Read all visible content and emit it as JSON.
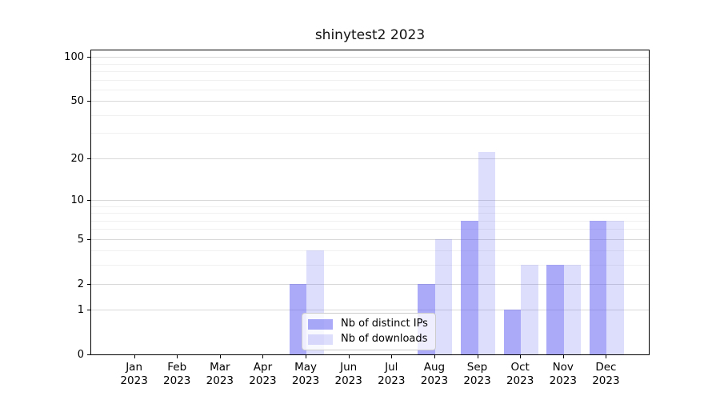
{
  "chart_data": {
    "type": "bar",
    "title": "shinytest2 2023",
    "categories": [
      "Jan 2023",
      "Feb 2023",
      "Mar 2023",
      "Apr 2023",
      "May 2023",
      "Jun 2023",
      "Jul 2023",
      "Aug 2023",
      "Sep 2023",
      "Oct 2023",
      "Nov 2023",
      "Dec 2023"
    ],
    "series": [
      {
        "name": "Nb of distinct IPs",
        "color": "rgba(85,85,242,0.5)",
        "values": [
          0,
          0,
          0,
          0,
          2,
          0,
          0,
          2,
          7,
          1,
          3,
          7
        ]
      },
      {
        "name": "Nb of downloads",
        "color": "rgba(85,85,242,0.2)",
        "values": [
          0,
          0,
          0,
          0,
          4,
          0,
          0,
          5,
          22,
          3,
          3,
          7
        ]
      }
    ],
    "yscale": "log1p",
    "yticks": [
      0,
      1,
      2,
      5,
      10,
      20,
      50,
      100
    ],
    "minor_yticks": [
      3,
      4,
      6,
      7,
      8,
      9,
      30,
      40,
      60,
      70,
      80,
      90
    ],
    "ylim": [
      0,
      111
    ],
    "xlabel": "",
    "ylabel": "",
    "grid": "on",
    "legend_position": "lower-center",
    "colors": {
      "grid_major": "#d9d9d9",
      "grid_minor": "#f0f0f0",
      "spine": "#000000",
      "bar_base": "#5555f2"
    }
  }
}
